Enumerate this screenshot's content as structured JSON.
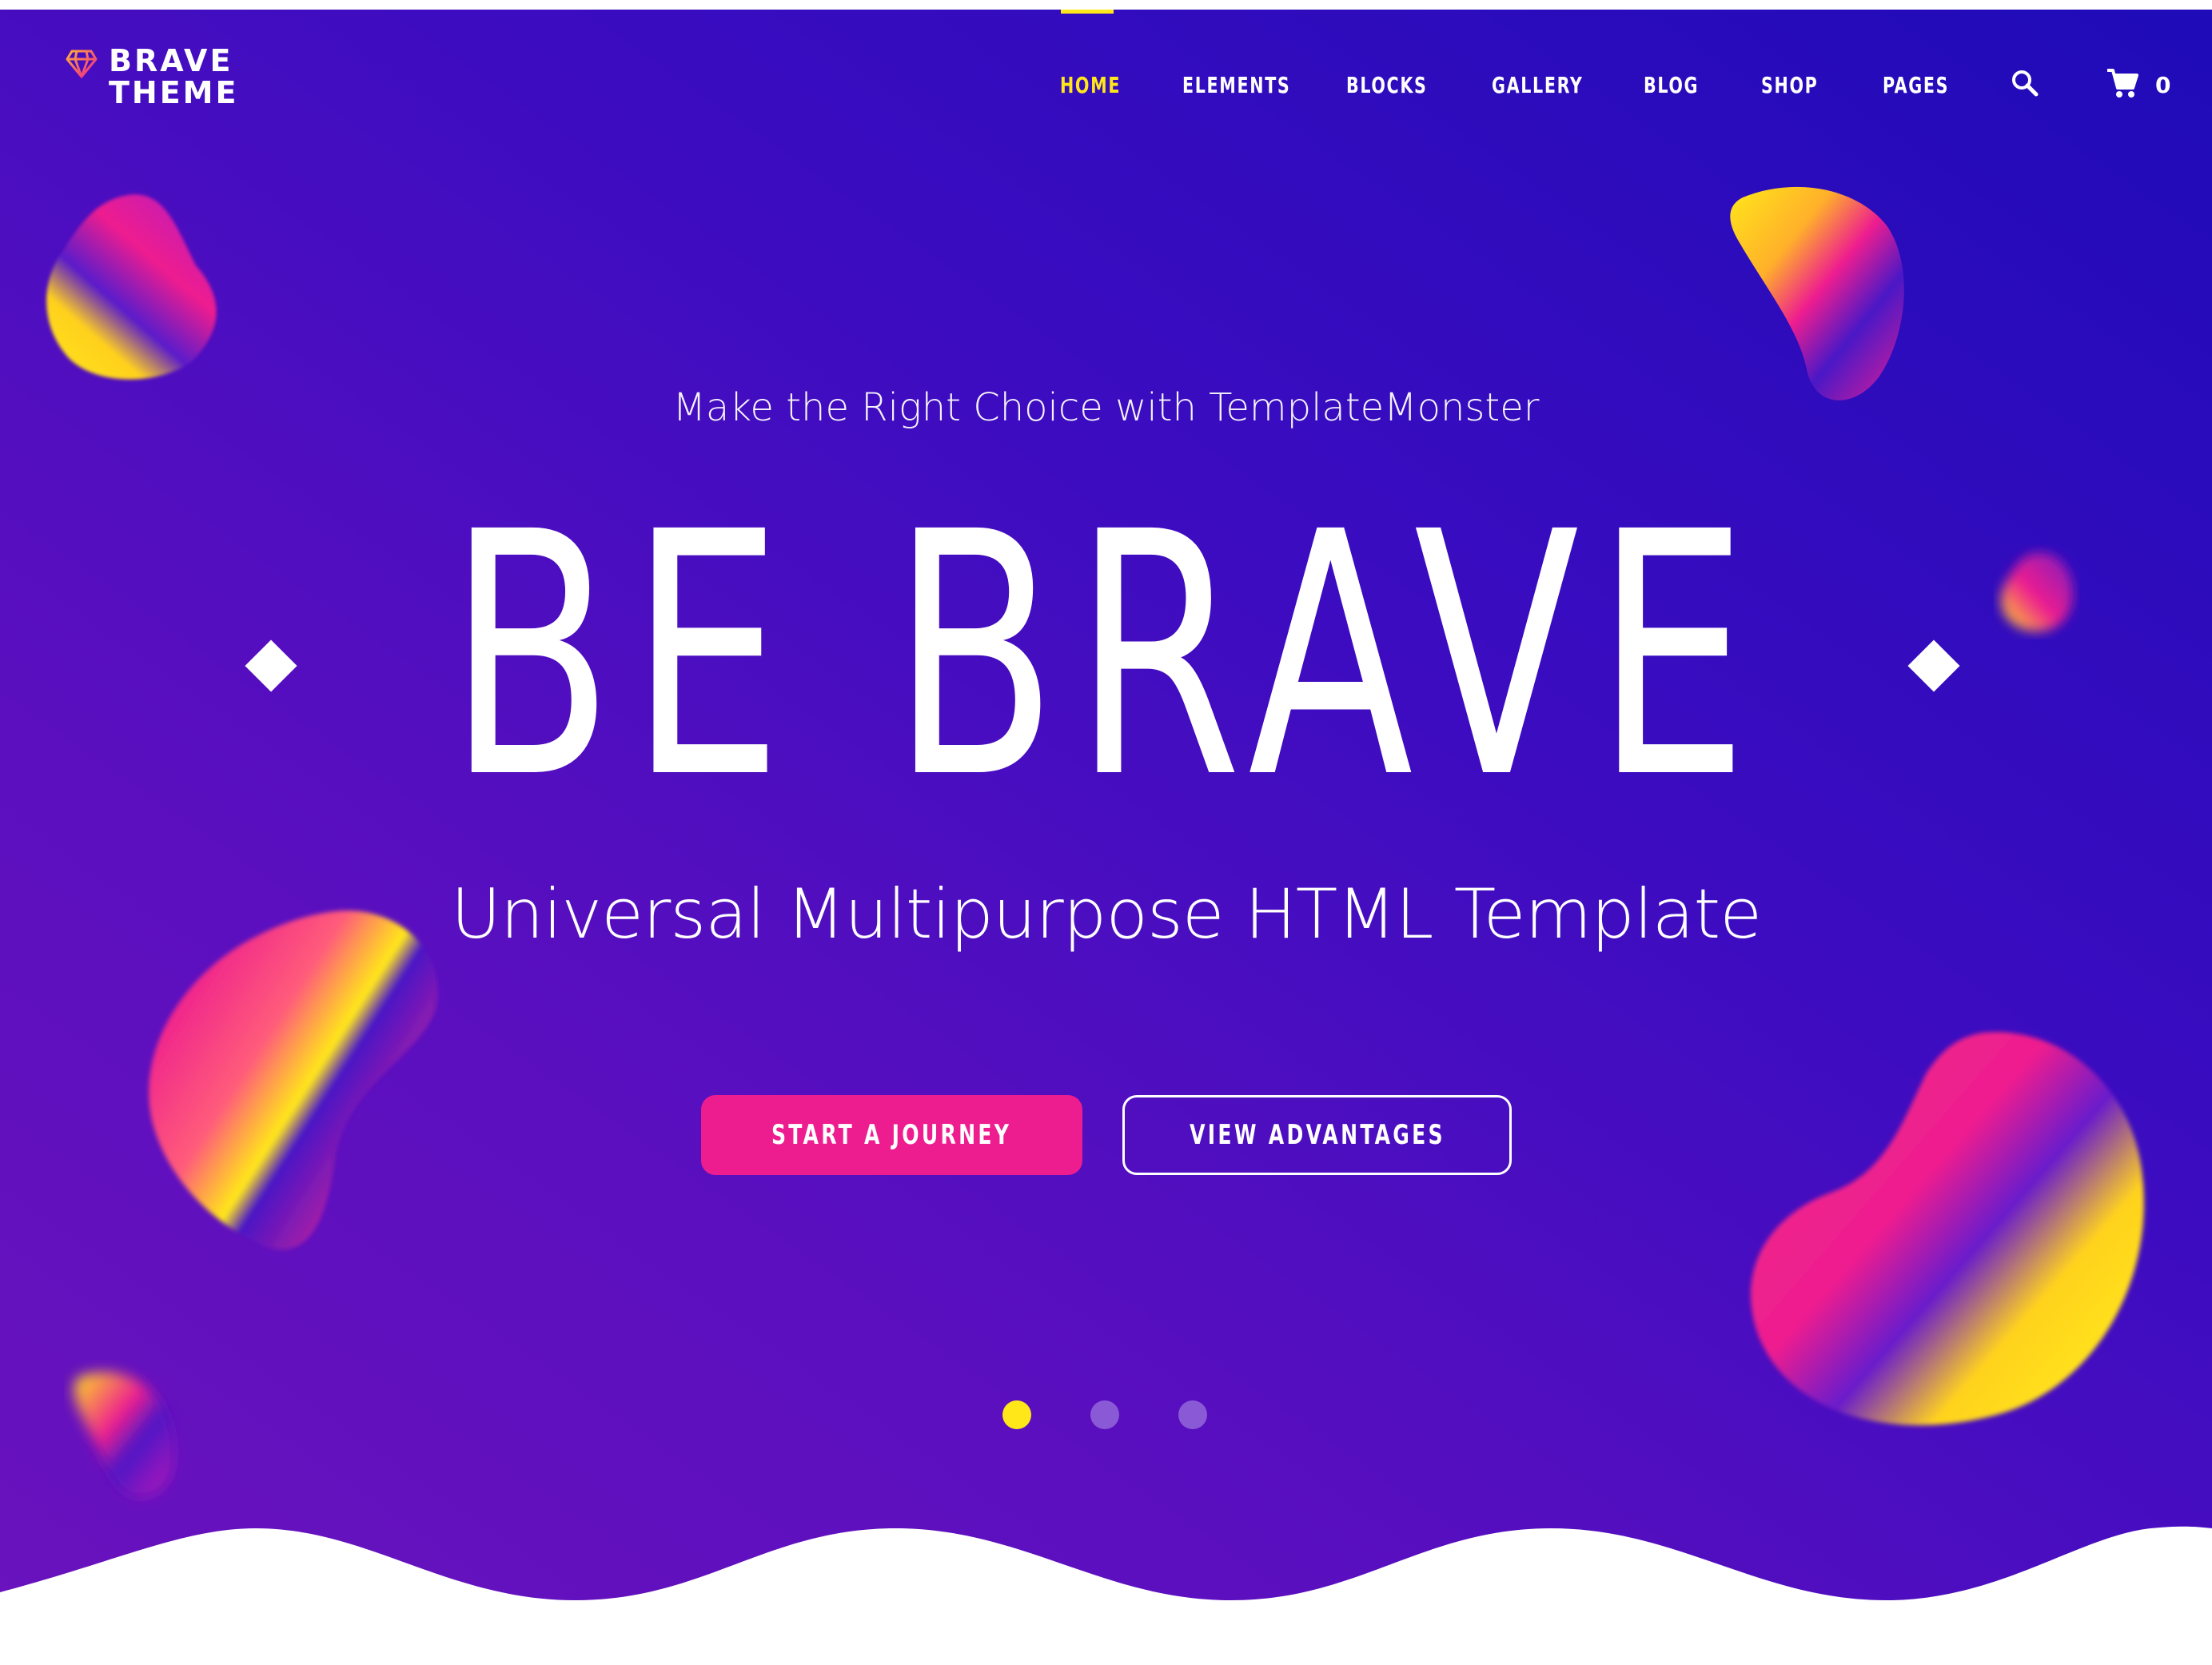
{
  "brand": {
    "line1": "BRAVE",
    "line2": "THEME"
  },
  "nav": {
    "items": [
      {
        "label": "HOME",
        "active": true
      },
      {
        "label": "ELEMENTS",
        "active": false
      },
      {
        "label": "BLOCKS",
        "active": false
      },
      {
        "label": "GALLERY",
        "active": false
      },
      {
        "label": "BLOG",
        "active": false
      },
      {
        "label": "SHOP",
        "active": false
      },
      {
        "label": "PAGES",
        "active": false
      }
    ],
    "search_icon": "search-icon",
    "cart_icon": "cart-icon",
    "cart_count": "0"
  },
  "hero": {
    "kicker": "Make the Right Choice with TemplateMonster",
    "headline": "BE BRAVE",
    "subhead": "Universal Multipurpose HTML Template",
    "primary_button": "START A JOURNEY",
    "secondary_button": "VIEW ADVANTAGES",
    "slider_total": 3,
    "slider_active": 1
  },
  "colors": {
    "accent_yellow": "#ffe71a",
    "accent_pink": "#ee1d8f",
    "bg_deep_blue": "#1f0bb8",
    "bg_purple": "#6a12bd"
  }
}
